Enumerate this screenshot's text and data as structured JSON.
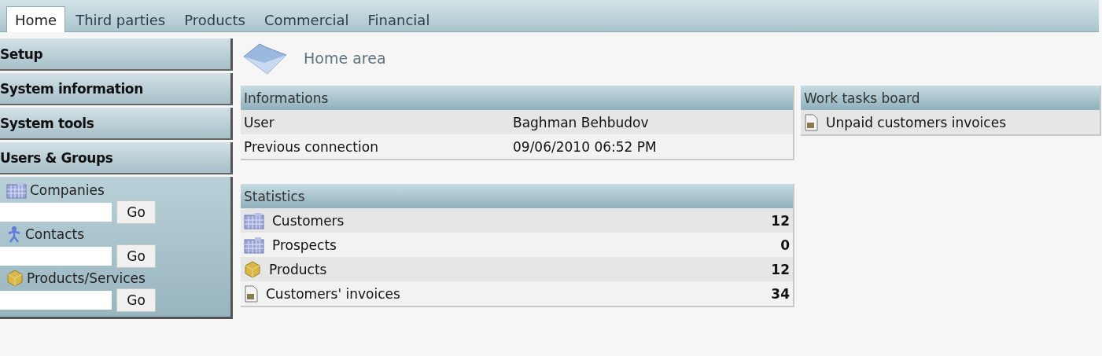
{
  "tabs": [
    {
      "label": "Home",
      "selected": true
    },
    {
      "label": "Third parties",
      "selected": false
    },
    {
      "label": "Products",
      "selected": false
    },
    {
      "label": "Commercial",
      "selected": false
    },
    {
      "label": "Financial",
      "selected": false
    }
  ],
  "sidebar": {
    "menu": [
      "Setup",
      "System information",
      "System tools",
      "Users & Groups"
    ],
    "searches": [
      {
        "kind": "company",
        "label": "Companies",
        "button": "Go"
      },
      {
        "kind": "contact",
        "label": "Contacts",
        "button": "Go"
      },
      {
        "kind": "product",
        "label": "Products/Services",
        "button": "Go"
      }
    ]
  },
  "page_title": "Home area",
  "informations": {
    "title": "Informations",
    "rows": [
      {
        "label": "User",
        "value": "Baghman Behbudov"
      },
      {
        "label": "Previous connection",
        "value": "09/06/2010 06:52 PM"
      }
    ]
  },
  "statistics": {
    "title": "Statistics",
    "rows": [
      {
        "kind": "company",
        "label": "Customers",
        "count": "12"
      },
      {
        "kind": "company",
        "label": "Prospects",
        "count": "0"
      },
      {
        "kind": "product",
        "label": "Products",
        "count": "12"
      },
      {
        "kind": "invoice",
        "label": "Customers' invoices",
        "count": "34"
      }
    ]
  },
  "work_board": {
    "title": "Work tasks board",
    "items": [
      {
        "kind": "invoice",
        "label": "Unpaid customers invoices"
      }
    ]
  }
}
